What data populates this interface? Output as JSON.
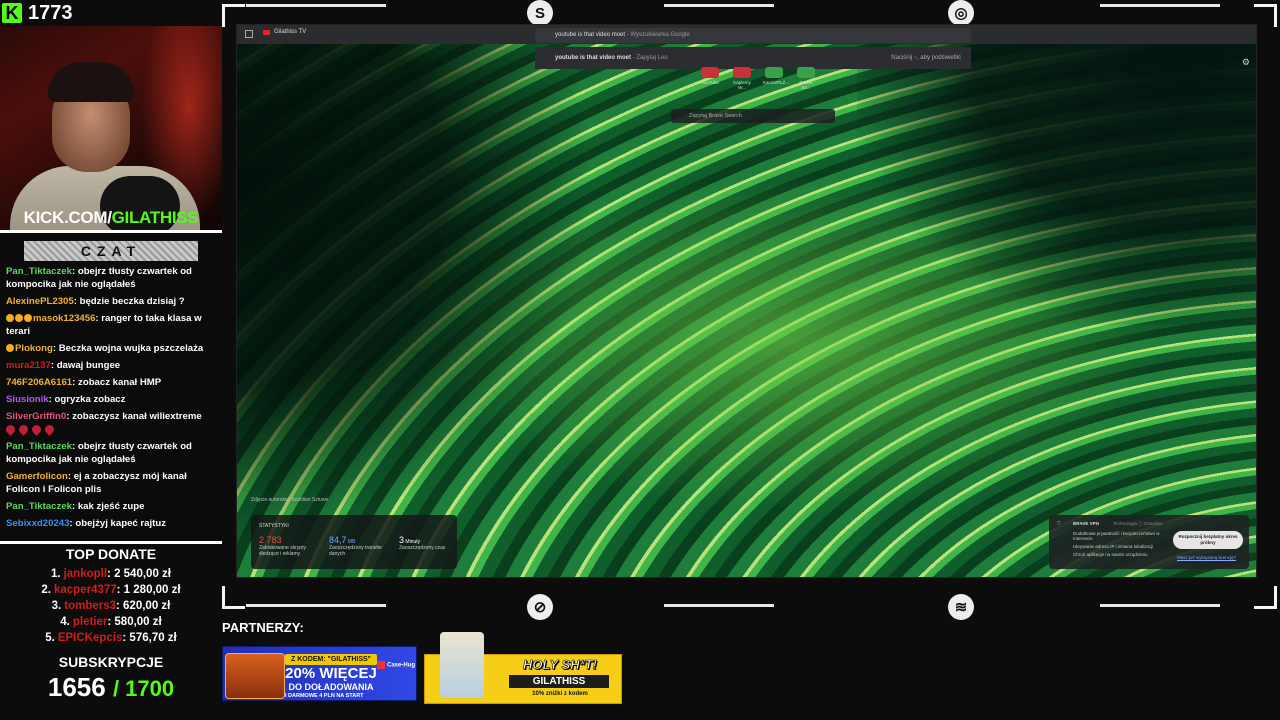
{
  "viewer_count": "1773",
  "kick_url": {
    "prefix": "KICK.COM/",
    "channel": "GILATHISS"
  },
  "chat": {
    "title": "CZAT",
    "messages": [
      {
        "user": "Pan_Tiktaczek",
        "color": "#5ed65e",
        "text": "obejrz tłusty czwartek od kompocika jak nie oglądałeś",
        "emotes_before": 0,
        "drops_after": 0
      },
      {
        "user": "AlexinePL2305",
        "color": "#f1b233",
        "text": "będzie beczka dzisiaj ?",
        "emotes_before": 0,
        "drops_after": 0
      },
      {
        "user": "masok123456",
        "color": "#f1b233",
        "text": "ranger to taka klasa w terari",
        "emotes_before": 3,
        "drops_after": 0
      },
      {
        "user": "Plokong",
        "color": "#f1b233",
        "text": "Beczka wojna wujka pszczelaża",
        "emotes_before": 1,
        "drops_after": 0
      },
      {
        "user": "mura2137",
        "color": "#d11d1d",
        "text": "dawaj bungee",
        "emotes_before": 0,
        "drops_after": 0
      },
      {
        "user": "746F206A6161",
        "color": "#f1b233",
        "text": "zobacz kanał HMP",
        "emotes_before": 0,
        "drops_after": 0
      },
      {
        "user": "Siusionik",
        "color": "#b15cf0",
        "text": "ogryzka zobacz",
        "emotes_before": 0,
        "drops_after": 0
      },
      {
        "user": "SilverGriffin0",
        "color": "#e0567b",
        "text": "zobaczysz kanał wiliextreme",
        "emotes_before": 0,
        "drops_after": 4
      },
      {
        "user": "Pan_Tiktaczek",
        "color": "#5ed65e",
        "text": "obejrz tłusty czwartek od kompocika jak nie oglądałeś",
        "emotes_before": 0,
        "drops_after": 0
      },
      {
        "user": "Gamerfolicon",
        "color": "#f1b233",
        "text": "ej a zobaczysz mój kanał Folicon i Folicon plis",
        "emotes_before": 0,
        "drops_after": 0
      },
      {
        "user": "Pan_Tiktaczek",
        "color": "#5ed65e",
        "text": "kak zjeść zupe",
        "emotes_before": 0,
        "drops_after": 0
      },
      {
        "user": "Sebixxd20243",
        "color": "#3b8ef0",
        "text": "obejżyj kapeć rajtuz",
        "emotes_before": 0,
        "drops_after": 0
      }
    ]
  },
  "top_donate": {
    "title": "TOP DONATE",
    "entries": [
      {
        "rank": "1.",
        "name": "jankopll",
        "amount": ": 2 540,00 zł"
      },
      {
        "rank": "2.",
        "name": "kacper4377",
        "amount": ": 1 280,00 zł"
      },
      {
        "rank": "3.",
        "name": "tombers3",
        "amount": ": 620,00 zł"
      },
      {
        "rank": "4.",
        "name": "pletier",
        "amount": ": 580,00 zł"
      },
      {
        "rank": "5.",
        "name": "EPICKepcis",
        "amount": ": 576,70 zł"
      }
    ]
  },
  "subs": {
    "title": "SUBSKRYPCJE",
    "current": "1656",
    "goal": "/ 1700"
  },
  "browser": {
    "tab_title": "Gilathiss TV",
    "omnibox_text": "youtube is that video moet",
    "omnibox_suffix": " - Wyszukiwarka Google",
    "suggestion_text": "youtube is that video moet",
    "suggestion_suffix": " - Zapytaj Leo",
    "suggestion_hint": "Naciśnij ↑, aby podświetlić",
    "shortcuts": [
      {
        "label": "YouTube",
        "color": "#c8323a"
      },
      {
        "label": "Kapiemy W...",
        "color": "#c8323a"
      },
      {
        "label": "KaczorPLZ...",
        "color": "#3aa04a"
      },
      {
        "label": "Psznik Str...",
        "color": "#3aa04a"
      }
    ],
    "brave_search_placeholder": "Zapytaj Brave Search",
    "photo_credit": "Zdjęcie autorstwa Bastilian Sztuwe",
    "stats": {
      "title": "STATYSTYKI",
      "items": [
        {
          "value": "2 783",
          "unit": "",
          "label": "Zablokowane skrypty śledzące i reklamy",
          "color": "#e0514b"
        },
        {
          "value": "84,7",
          "unit": " MB",
          "label": "Zaoszczędzony transfer danych",
          "color": "#7aa0ff"
        },
        {
          "value": "3",
          "unit": " Minuty",
          "label": "Zaoszczędzony czas",
          "color": "#ffffff"
        }
      ]
    },
    "vpn": {
      "title": "BRAVE VPN",
      "subtitle": "Technologia ⓘ Guardian",
      "features": [
        "Dodatkowa prywatność i bezpieczeństwo w Internecie",
        "Ukrywanie adresu IP i zmiana lokalizacji",
        "Chroń aplikacje na swoim urządzeniu"
      ],
      "cta": "Rozpocznij bezpłatny okres próbny",
      "link": "Masz już wykupioną licencję?"
    }
  },
  "partners": {
    "label": "PARTNERZY:",
    "banner1": {
      "code_pill": "Z KODEM: \"GILATHISS\"",
      "headline": "20% WIĘCEJ",
      "sub": "DO DOŁADOWANIA",
      "footer": "I DARMOWE 4 PLN NA START",
      "brand": "Case-Hug"
    },
    "banner2": {
      "headline": "HOLY SH*T!",
      "code": "GILATHISS",
      "footer": "10% zniżki z kodem"
    }
  }
}
